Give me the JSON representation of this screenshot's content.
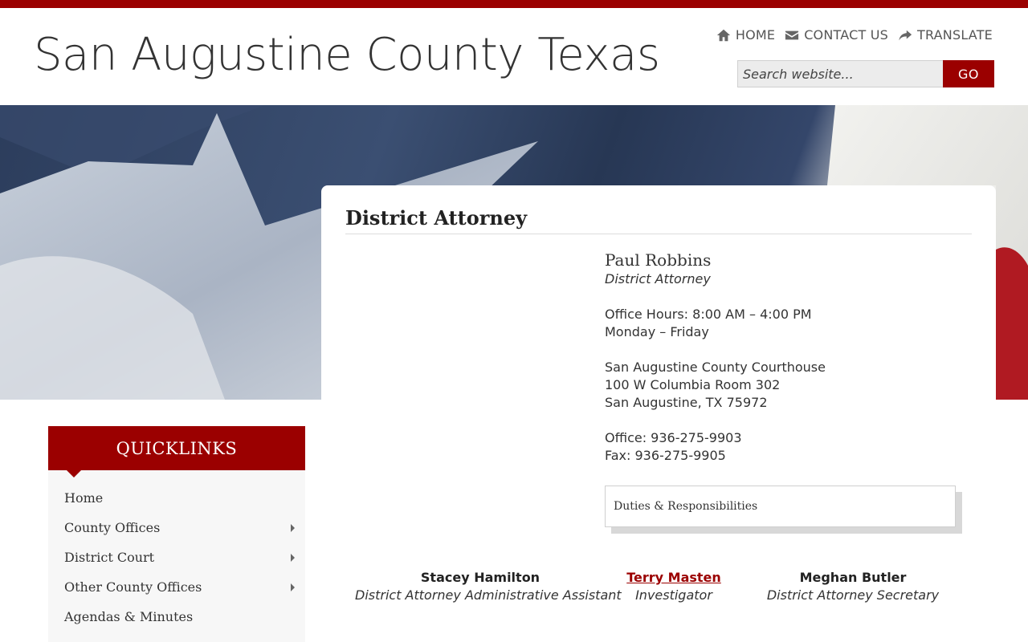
{
  "site": {
    "title": "San Augustine County Texas",
    "accent_color": "#9b0000"
  },
  "top_nav": [
    {
      "label": "HOME",
      "icon": "home-icon"
    },
    {
      "label": "CONTACT US",
      "icon": "envelope-icon"
    },
    {
      "label": "TRANSLATE",
      "icon": "share-arrow-icon"
    }
  ],
  "search": {
    "placeholder": "Search website...",
    "button_label": "GO"
  },
  "page": {
    "title": "District Attorney"
  },
  "profile": {
    "name": "Paul Robbins",
    "role": "District Attorney",
    "hours_line1": "Office Hours: 8:00 AM – 4:00 PM",
    "hours_line2": "Monday – Friday",
    "address_line1": "San Augustine County Courthouse",
    "address_line2": "100 W Columbia Room 302",
    "address_line3": "San Augustine, TX 75972",
    "office_phone": "Office: 936-275-9903",
    "fax": "Fax: 936-275-9905"
  },
  "duties": {
    "label": "Duties & Responsibilities"
  },
  "staff": [
    {
      "name": "Stacey Hamilton",
      "role": "District Attorney Administrative Assistant",
      "is_link": false
    },
    {
      "name": "Terry Masten",
      "role": "Investigator",
      "is_link": true
    },
    {
      "name": "Meghan Butler",
      "role": "District Attorney Secretary",
      "is_link": false
    }
  ],
  "quicklinks": {
    "header": "QUICKLINKS",
    "items": [
      {
        "label": "Home",
        "has_submenu": false
      },
      {
        "label": "County Offices",
        "has_submenu": true
      },
      {
        "label": "District Court",
        "has_submenu": true
      },
      {
        "label": "Other County Offices",
        "has_submenu": true
      },
      {
        "label": "Agendas & Minutes",
        "has_submenu": false
      }
    ]
  }
}
